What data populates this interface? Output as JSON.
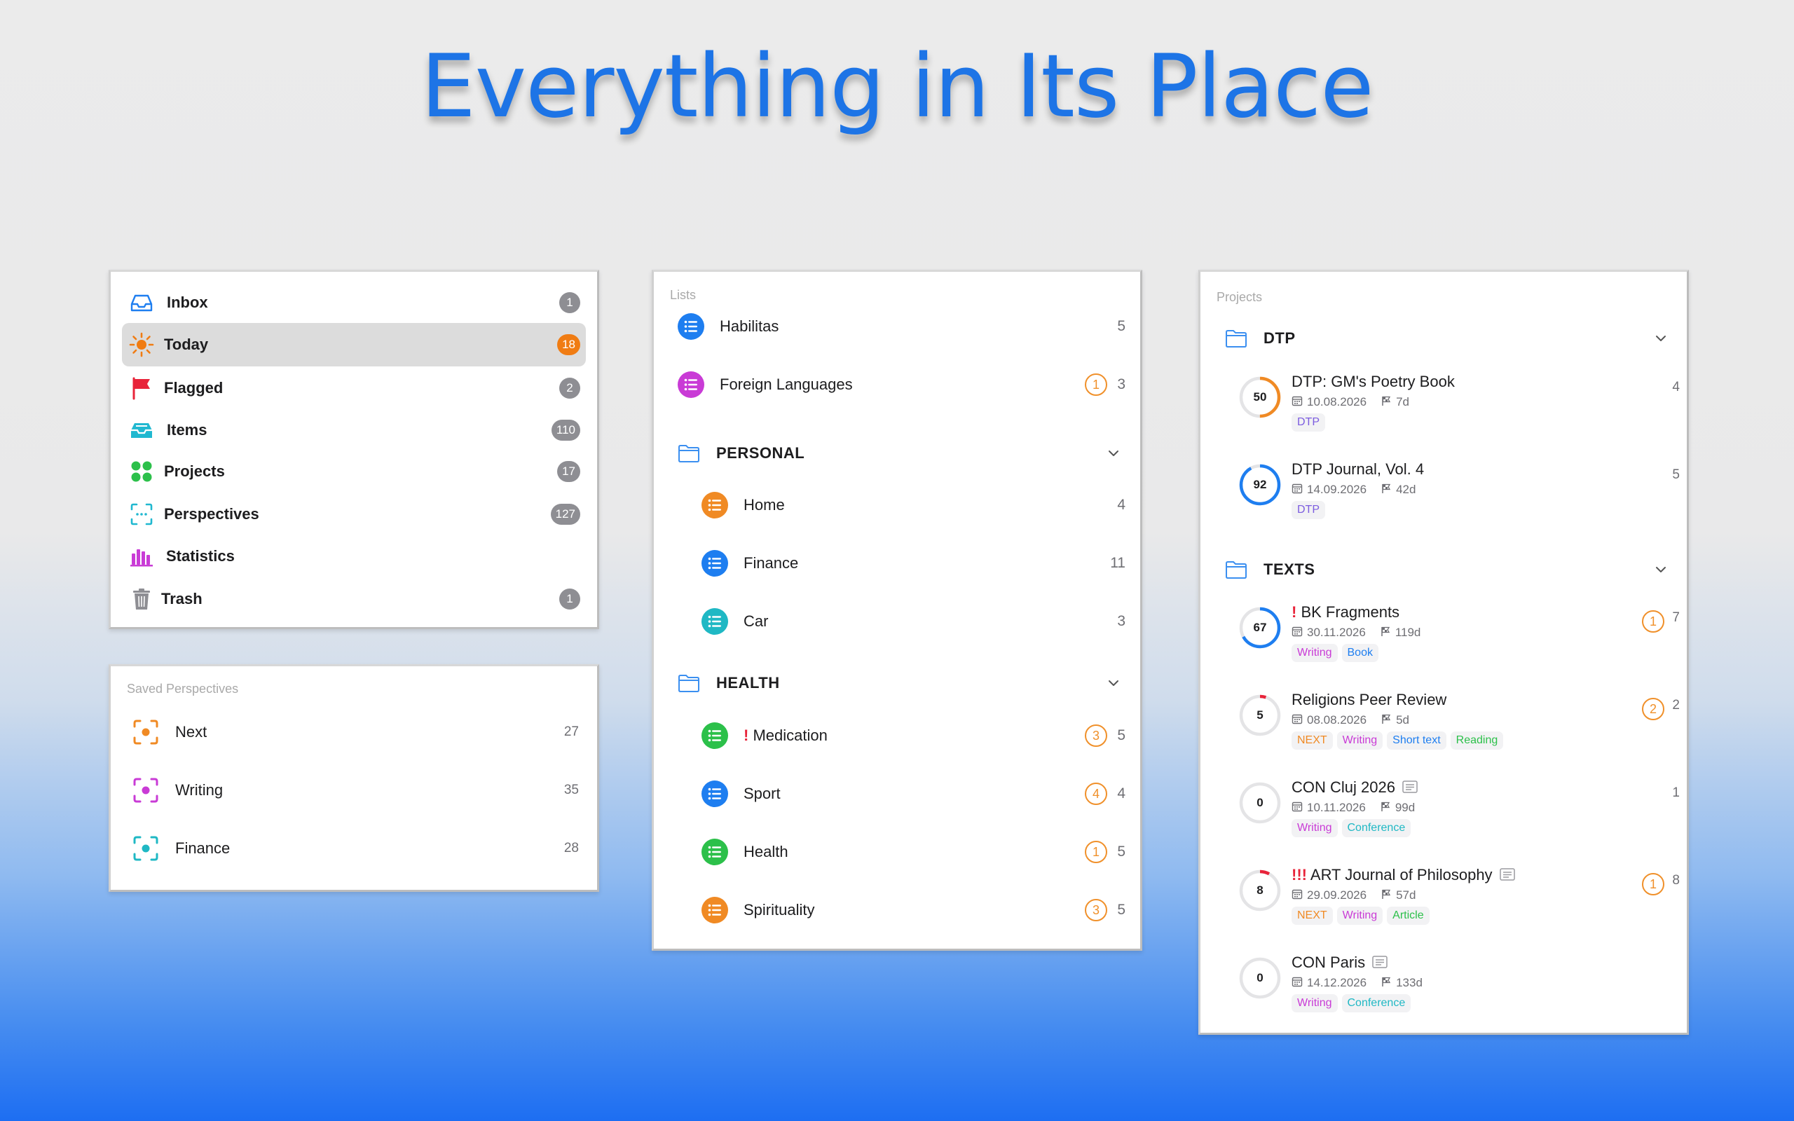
{
  "headline": "Everything in Its Place",
  "sidebar": {
    "items": [
      {
        "label": "Inbox",
        "count": "1",
        "icon": "inbox-icon"
      },
      {
        "label": "Today",
        "count": "18",
        "icon": "sun-icon",
        "selected": true
      },
      {
        "label": "Flagged",
        "count": "2",
        "icon": "flag-icon"
      },
      {
        "label": "Items",
        "count": "110",
        "icon": "tray-icon"
      },
      {
        "label": "Projects",
        "count": "17",
        "icon": "grid-dots-icon"
      },
      {
        "label": "Perspectives",
        "count": "127",
        "icon": "viewfinder-icon"
      },
      {
        "label": "Statistics",
        "count": "",
        "icon": "bar-chart-icon"
      },
      {
        "label": "Trash",
        "count": "1",
        "icon": "trash-icon"
      }
    ]
  },
  "perspectives": {
    "header": "Saved Perspectives",
    "items": [
      {
        "label": "Next",
        "count": "27",
        "color": "#f08a24"
      },
      {
        "label": "Writing",
        "count": "35",
        "color": "#c93bd6"
      },
      {
        "label": "Finance",
        "count": "28",
        "color": "#1fb8c4"
      }
    ]
  },
  "lists": {
    "header": "Lists",
    "top": [
      {
        "label": "Habilitas",
        "count": "5",
        "badge": "",
        "color": "#1e7ef0"
      },
      {
        "label": "Foreign Languages",
        "count": "3",
        "badge": "1",
        "color": "#c93bd6"
      }
    ],
    "folders": [
      {
        "label": "PERSONAL",
        "items": [
          {
            "label": "Home",
            "count": "4",
            "badge": "",
            "color": "#f08a24",
            "excl": ""
          },
          {
            "label": "Finance",
            "count": "11",
            "badge": "",
            "color": "#1e7ef0",
            "excl": ""
          },
          {
            "label": "Car",
            "count": "3",
            "badge": "",
            "color": "#1fb8c4",
            "excl": ""
          }
        ]
      },
      {
        "label": "HEALTH",
        "items": [
          {
            "label": "Medication",
            "count": "5",
            "badge": "3",
            "color": "#2cc04a",
            "excl": "!"
          },
          {
            "label": "Sport",
            "count": "4",
            "badge": "4",
            "color": "#1e7ef0",
            "excl": ""
          },
          {
            "label": "Health",
            "count": "5",
            "badge": "1",
            "color": "#2cc04a",
            "excl": ""
          },
          {
            "label": "Spirituality",
            "count": "5",
            "badge": "3",
            "color": "#f08a24",
            "excl": ""
          }
        ]
      }
    ]
  },
  "projects": {
    "header": "Projects",
    "folders": [
      {
        "label": "DTP",
        "items": [
          {
            "progress": "50",
            "title": "DTP: GM's Poetry Book",
            "excl": "",
            "date": "10.08.2026",
            "days": "7d",
            "count": "4",
            "badge": "",
            "note": false,
            "tags": [
              {
                "text": "DTP",
                "color": "#7c5ce0"
              }
            ],
            "ring_color": "#f08a24",
            "fraction": 0.5
          },
          {
            "progress": "92",
            "title": "DTP Journal, Vol. 4",
            "excl": "",
            "date": "14.09.2026",
            "days": "42d",
            "count": "5",
            "badge": "",
            "note": false,
            "tags": [
              {
                "text": "DTP",
                "color": "#7c5ce0"
              }
            ],
            "ring_color": "#1e7ef0",
            "fraction": 0.92
          }
        ]
      },
      {
        "label": "TEXTS",
        "items": [
          {
            "progress": "67",
            "title": "BK Fragments",
            "excl": "!",
            "date": "30.11.2026",
            "days": "119d",
            "count": "7",
            "badge": "1",
            "note": false,
            "tags": [
              {
                "text": "Writing",
                "color": "#c93bd6"
              },
              {
                "text": "Book",
                "color": "#1e7ef0"
              }
            ],
            "ring_color": "#1e7ef0",
            "fraction": 0.67
          },
          {
            "progress": "5",
            "title": "Religions Peer Review",
            "excl": "",
            "date": "08.08.2026",
            "days": "5d",
            "count": "2",
            "badge": "2",
            "note": false,
            "tags": [
              {
                "text": "NEXT",
                "color": "#f08a24"
              },
              {
                "text": "Writing",
                "color": "#c93bd6"
              },
              {
                "text": "Short text",
                "color": "#1e7ef0"
              },
              {
                "text": "Reading",
                "color": "#2cc04a"
              }
            ],
            "ring_color": "#e8243a",
            "fraction": 0.05
          },
          {
            "progress": "0",
            "title": "CON Cluj 2026",
            "excl": "",
            "date": "10.11.2026",
            "days": "99d",
            "count": "1",
            "badge": "",
            "note": true,
            "tags": [
              {
                "text": "Writing",
                "color": "#c93bd6"
              },
              {
                "text": "Conference",
                "color": "#1fb8c4"
              }
            ],
            "ring_color": "#cccccc",
            "fraction": 0
          },
          {
            "progress": "8",
            "title": "ART Journal of Philosophy",
            "excl": "!!!",
            "date": "29.09.2026",
            "days": "57d",
            "count": "8",
            "badge": "1",
            "note": true,
            "tags": [
              {
                "text": "NEXT",
                "color": "#f08a24"
              },
              {
                "text": "Writing",
                "color": "#c93bd6"
              },
              {
                "text": "Article",
                "color": "#2cc04a"
              }
            ],
            "ring_color": "#e8243a",
            "fraction": 0.08
          },
          {
            "progress": "0",
            "title": "CON Paris",
            "excl": "",
            "date": "14.12.2026",
            "days": "133d",
            "count": "",
            "badge": "",
            "note": true,
            "tags": [
              {
                "text": "Writing",
                "color": "#c93bd6"
              },
              {
                "text": "Conference",
                "color": "#1fb8c4"
              }
            ],
            "ring_color": "#cccccc",
            "fraction": 0
          }
        ]
      }
    ]
  },
  "colors": {
    "accent": "#1d74e6",
    "orange": "#f07c13",
    "badge_gray": "#8e8e93"
  }
}
